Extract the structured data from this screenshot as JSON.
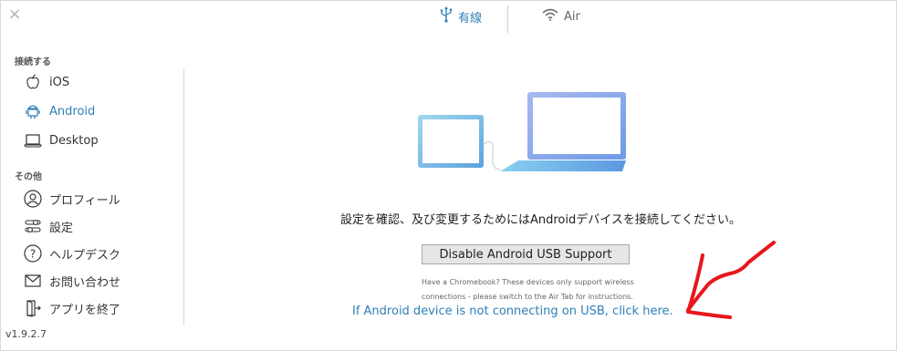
{
  "window": {
    "close_icon": "close-icon"
  },
  "tabs": [
    {
      "label": "有線",
      "icon": "usb-icon",
      "active": true
    },
    {
      "label": "Air",
      "icon": "wifi-icon",
      "active": false
    }
  ],
  "sidebar": {
    "connect_title": "接続する",
    "connect_items": [
      {
        "label": "iOS",
        "icon": "apple-icon"
      },
      {
        "label": "Android",
        "icon": "android-icon",
        "active": true
      },
      {
        "label": "Desktop",
        "icon": "laptop-icon"
      }
    ],
    "other_title": "その他",
    "other_items": [
      {
        "label": "プロフィール",
        "icon": "profile-icon"
      },
      {
        "label": "設定",
        "icon": "settings-icon"
      },
      {
        "label": "ヘルプデスク",
        "icon": "help-icon"
      },
      {
        "label": "お問い合わせ",
        "icon": "mail-icon"
      },
      {
        "label": "アプリを終了",
        "icon": "exit-icon"
      }
    ],
    "version": "v1.9.2.7"
  },
  "main": {
    "instruction": "設定を確認、及び変更するためにはAndroidデバイスを接続してください。",
    "disable_button": "Disable Android USB Support",
    "note_line1": "Have a Chromebook? These devices only support wireless",
    "note_line2": "connections - please switch to the Air Tab for instructions.",
    "usb_link": "If Android device is not connecting on USB, click here."
  },
  "colors": {
    "accent": "#2f7fb7",
    "annotation": "#e8161b"
  }
}
